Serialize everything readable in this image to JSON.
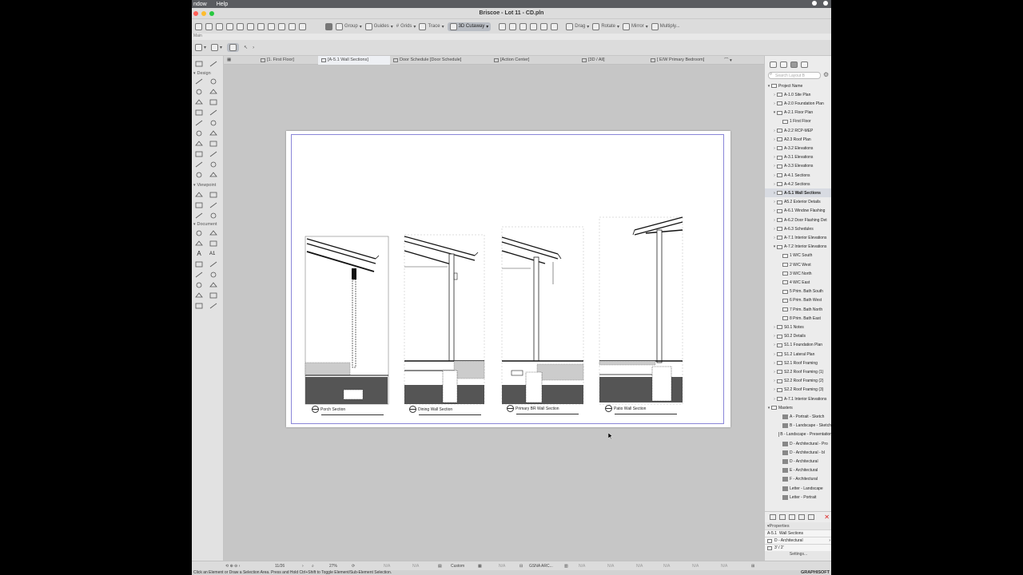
{
  "menubar": {
    "items": [
      "ndow",
      "Help"
    ]
  },
  "window": {
    "title": "Briscoe - Lot 11 - CD.pln",
    "traffic_colors": [
      "#ff5f57",
      "#febc2e",
      "#28c840"
    ]
  },
  "toolbar": {
    "group": "Group",
    "guides": "Guides",
    "grids": "Grids",
    "trace": "Trace",
    "cutaway": "3D Cutaway",
    "drag": "Drag",
    "rotate": "Rotate",
    "mirror": "Mirror",
    "multiply": "Multiply...",
    "main_label": "Main"
  },
  "tabs": [
    {
      "label": "[1. First Floor]",
      "active": false
    },
    {
      "label": "[A-5.1 Wall Sections]",
      "active": true
    },
    {
      "label": "Door Schedule [Door Schedule]",
      "active": false
    },
    {
      "label": "[Action Center]",
      "active": false
    },
    {
      "label": "[3D / All]",
      "active": false
    },
    {
      "label": "[ E/W Primary Bedroom]",
      "active": false
    }
  ],
  "toolbox": {
    "sections": [
      "Design",
      "Viewpoint",
      "Document"
    ],
    "text_tool": "A",
    "label_tool": "A1"
  },
  "details": [
    {
      "label": "Porch Section"
    },
    {
      "label": "Dining Wall Section"
    },
    {
      "label": "Primary BR Wall Section"
    },
    {
      "label": "Patio Wall Section"
    }
  ],
  "navigator": {
    "search_placeholder": "Search Layout B",
    "tree": [
      {
        "label": "Project Name",
        "level": 0,
        "arrow": "▾",
        "icon": "sheet"
      },
      {
        "label": "A-1.0 Site Plan",
        "level": 1,
        "arrow": "›",
        "icon": "sheet"
      },
      {
        "label": "A-2.0 Foundation Plan",
        "level": 1,
        "arrow": "›",
        "icon": "sheet"
      },
      {
        "label": "A-2.1 Floor Plan",
        "level": 1,
        "arrow": "▾",
        "icon": "sheet"
      },
      {
        "label": "1 First Floor",
        "level": 2,
        "arrow": "",
        "icon": "sheet"
      },
      {
        "label": "A-2.2 RCP-MEP",
        "level": 1,
        "arrow": "›",
        "icon": "sheet"
      },
      {
        "label": "A2.3 Roof Plan",
        "level": 1,
        "arrow": "›",
        "icon": "sheet"
      },
      {
        "label": "A-3.2 Elevations",
        "level": 1,
        "arrow": "›",
        "icon": "sheet"
      },
      {
        "label": "A-3.1 Elevations",
        "level": 1,
        "arrow": "›",
        "icon": "sheet"
      },
      {
        "label": "A-3.3 Elevations",
        "level": 1,
        "arrow": "›",
        "icon": "sheet"
      },
      {
        "label": "A-4.1 Sections",
        "level": 1,
        "arrow": "›",
        "icon": "sheet"
      },
      {
        "label": "A-4.2 Sections",
        "level": 1,
        "arrow": "›",
        "icon": "sheet"
      },
      {
        "label": "A-5.1 Wall Sections",
        "level": 1,
        "arrow": "›",
        "icon": "sheet",
        "selected": true
      },
      {
        "label": "A5.2 Exterior Details",
        "level": 1,
        "arrow": "›",
        "icon": "sheet"
      },
      {
        "label": "A-6.1 Window Flashing",
        "level": 1,
        "arrow": "›",
        "icon": "sheet"
      },
      {
        "label": "A-6.2 Door Flashing Det",
        "level": 1,
        "arrow": "›",
        "icon": "sheet"
      },
      {
        "label": "A-6.3 Schedules",
        "level": 1,
        "arrow": "›",
        "icon": "sheet"
      },
      {
        "label": "A-7.1 Interior Elevations",
        "level": 1,
        "arrow": "›",
        "icon": "sheet"
      },
      {
        "label": "A-7.2 Interior Elevations",
        "level": 1,
        "arrow": "▾",
        "icon": "sheet"
      },
      {
        "label": "1 W/C South",
        "level": 2,
        "arrow": "",
        "icon": "sheet"
      },
      {
        "label": "2 W/C West",
        "level": 2,
        "arrow": "",
        "icon": "sheet"
      },
      {
        "label": "3 W/C North",
        "level": 2,
        "arrow": "",
        "icon": "sheet"
      },
      {
        "label": "4 W/C East",
        "level": 2,
        "arrow": "",
        "icon": "sheet"
      },
      {
        "label": "5 Prim. Bath South",
        "level": 2,
        "arrow": "",
        "icon": "sheet"
      },
      {
        "label": "6 Prim. Bath West",
        "level": 2,
        "arrow": "",
        "icon": "sheet"
      },
      {
        "label": "7 Prim. Bath North",
        "level": 2,
        "arrow": "",
        "icon": "sheet"
      },
      {
        "label": "8 Prim. Bath East",
        "level": 2,
        "arrow": "",
        "icon": "sheet"
      },
      {
        "label": "S0.1 Notes",
        "level": 1,
        "arrow": "›",
        "icon": "sheet"
      },
      {
        "label": "S0.2 Details",
        "level": 1,
        "arrow": "›",
        "icon": "sheet"
      },
      {
        "label": "S1.1 Foundation Plan",
        "level": 1,
        "arrow": "›",
        "icon": "sheet"
      },
      {
        "label": "S1.2 Lateral Plan",
        "level": 1,
        "arrow": "›",
        "icon": "sheet"
      },
      {
        "label": "S2.1 Roof Framing",
        "level": 1,
        "arrow": "›",
        "icon": "sheet"
      },
      {
        "label": "S2.2 Roof Framing (1)",
        "level": 1,
        "arrow": "›",
        "icon": "sheet"
      },
      {
        "label": "S2.2 Roof Framing (2)",
        "level": 1,
        "arrow": "›",
        "icon": "sheet"
      },
      {
        "label": "S2.2 Roof Framing (3)",
        "level": 1,
        "arrow": "›",
        "icon": "sheet"
      },
      {
        "label": "A-7.1 Interior Elevations",
        "level": 1,
        "arrow": "›",
        "icon": "sheet"
      },
      {
        "label": "Masters",
        "level": 0,
        "arrow": "▾",
        "icon": "sheet"
      },
      {
        "label": "A - Portrait - Sketch",
        "level": 2,
        "arrow": "",
        "icon": "master"
      },
      {
        "label": "B - Landscape - Sketch",
        "level": 2,
        "arrow": "",
        "icon": "master"
      },
      {
        "label": "B - Landscape - Presentation",
        "level": 2,
        "arrow": "",
        "icon": "master"
      },
      {
        "label": "D - Architectural - Pro",
        "level": 2,
        "arrow": "",
        "icon": "master"
      },
      {
        "label": "D - Architectural - bl",
        "level": 2,
        "arrow": "",
        "icon": "master"
      },
      {
        "label": "D - Architectural",
        "level": 2,
        "arrow": "",
        "icon": "master"
      },
      {
        "label": "E - Architectural",
        "level": 2,
        "arrow": "",
        "icon": "master"
      },
      {
        "label": "F - Architectural",
        "level": 2,
        "arrow": "",
        "icon": "master"
      },
      {
        "label": "Letter - Landscape",
        "level": 2,
        "arrow": "",
        "icon": "master"
      },
      {
        "label": "Letter - Portrait",
        "level": 2,
        "arrow": "",
        "icon": "master"
      }
    ]
  },
  "properties": {
    "header": "Properties",
    "sheet_id": "A-5.1",
    "sheet_name": "Wall Sections",
    "master": "D - Architectural",
    "scale": "3' / 2'",
    "settings": "Settings..."
  },
  "status": {
    "page": "11/26",
    "zoom": "27%",
    "scale_mode": "Custom",
    "na": "N/A",
    "layer": "GSNA ARC..."
  },
  "hint": {
    "text": "Click an Element or Draw a Selection Area. Press and Hold Ctrl+Shift to Toggle Element/Sub-Element Selection.",
    "brand": "GRAPHISOFT"
  }
}
